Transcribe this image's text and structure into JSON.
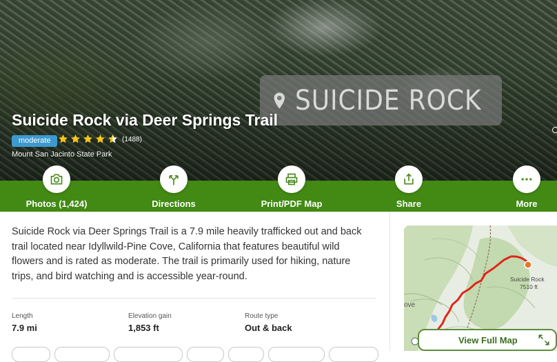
{
  "hero": {
    "sign_text": "SUICIDE ROCK",
    "title": "Suicide Rock via Deer Springs Trail",
    "difficulty": "moderate",
    "rating": 4.5,
    "review_count": "(1488)",
    "park": "Mount San Jacinto State Park"
  },
  "actions": [
    {
      "label": "Photos (1,424)",
      "icon": "camera-icon"
    },
    {
      "label": "Directions",
      "icon": "directions-icon"
    },
    {
      "label": "Print/PDF Map",
      "icon": "printer-icon"
    },
    {
      "label": "Share",
      "icon": "share-icon"
    },
    {
      "label": "More",
      "icon": "more-icon"
    }
  ],
  "description": "Suicide Rock via Deer Springs Trail is a 7.9 mile heavily trafficked out and back trail located near Idyllwild-Pine Cove, California that features beautiful wild flowers and is rated as moderate. The trail is primarily used for hiking, nature trips, and bird watching and is accessible year-round.",
  "stats": [
    {
      "label": "Length",
      "value": "7.9 mi"
    },
    {
      "label": "Elevation gain",
      "value": "1,853 ft"
    },
    {
      "label": "Route type",
      "value": "Out & back"
    }
  ],
  "map": {
    "peak_name": "Suicide Rock",
    "peak_elevation": "7510 ft",
    "partial_label": "ove",
    "full_map_label": "View Full Map"
  },
  "colors": {
    "brand_green": "#428a13",
    "difficulty_blue": "#3c9ad1",
    "star_gold": "#f5c518",
    "trail_red": "#e0251b"
  }
}
